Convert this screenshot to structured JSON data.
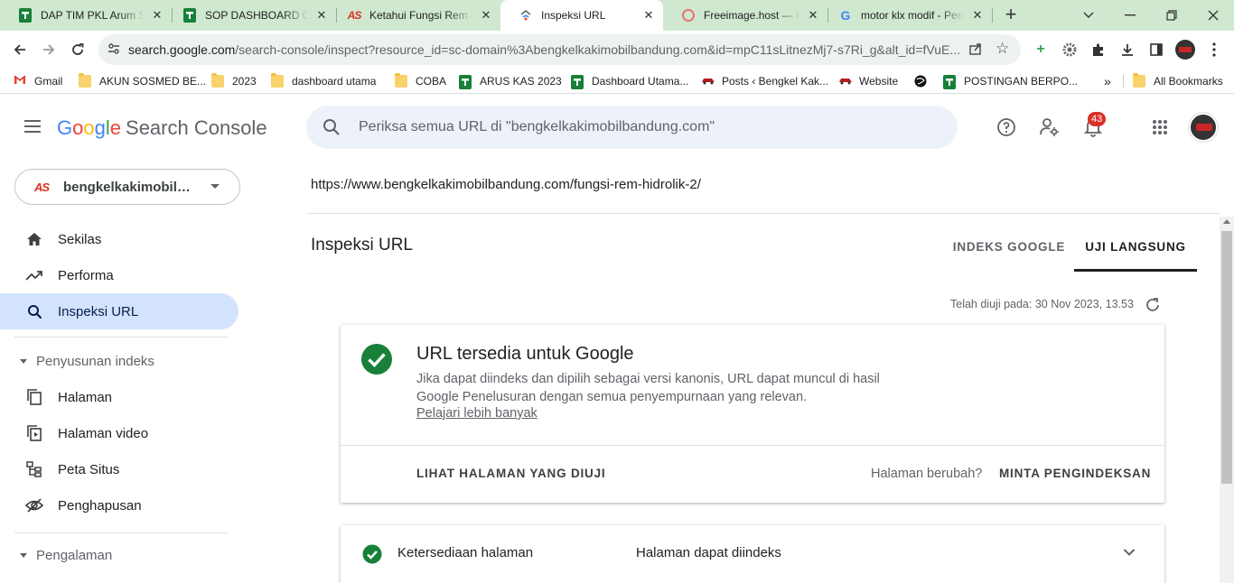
{
  "browser": {
    "tabs": [
      {
        "title": "DAP TIM PKL Arum Sa",
        "icon": "sheets-icon",
        "active": false
      },
      {
        "title": "SOP DASHBOARD OP",
        "icon": "sheets-icon",
        "active": false
      },
      {
        "title": "Ketahui Fungsi Rem H",
        "icon": "as-logo-icon",
        "active": false
      },
      {
        "title": "Inspeksi URL",
        "icon": "search-console-icon",
        "active": true
      },
      {
        "title": "Freeimage.host — Ho",
        "icon": "freeimage-icon",
        "active": false
      },
      {
        "title": "motor klx modif - Pen",
        "icon": "google-icon",
        "active": false
      }
    ],
    "url_host": "search.google.com",
    "url_path": "/search-console/inspect?resource_id=sc-domain%3Abengkelkakimobilbandung.com&id=mpC11sLitnezMj7-s7Ri_g&alt_id=fVuE...",
    "bookmarks": [
      {
        "label": "Gmail",
        "icon": "gmail-icon"
      },
      {
        "label": "AKUN SOSMED BE...",
        "icon": "folder-icon"
      },
      {
        "label": "2023",
        "icon": "folder-icon"
      },
      {
        "label": "dashboard utama",
        "icon": "folder-icon"
      },
      {
        "label": "COBA",
        "icon": "folder-icon"
      },
      {
        "label": "ARUS KAS 2023",
        "icon": "sheets-icon"
      },
      {
        "label": "Dashboard Utama...",
        "icon": "sheets-icon"
      },
      {
        "label": "Posts ‹ Bengkel Kak...",
        "icon": "car-icon"
      },
      {
        "label": "Website",
        "icon": "car-icon"
      },
      {
        "label": "",
        "icon": "globe-dark-icon"
      },
      {
        "label": "POSTINGAN BERPO...",
        "icon": "sheets-icon"
      }
    ],
    "overflow_label": "»",
    "all_bookmarks_label": "All Bookmarks"
  },
  "header": {
    "logo_google": [
      "G",
      "o",
      "o",
      "g",
      "l",
      "e"
    ],
    "logo_product": "Search Console",
    "search_placeholder": "Periksa semua URL di \"bengkelkakimobilbandung.com\"",
    "notifications_count": "43"
  },
  "sidebar": {
    "property": "bengkelkakimobilbandung.com",
    "property_short": "bengkelkakimobilba...",
    "items": [
      {
        "label": "Sekilas",
        "icon": "home-icon",
        "active": false
      },
      {
        "label": "Performa",
        "icon": "trending-up-icon",
        "active": false
      },
      {
        "label": "Inspeksi URL",
        "icon": "search-icon",
        "active": true
      }
    ],
    "section_indexing": "Penyusunan indeks",
    "indexing_items": [
      {
        "label": "Halaman",
        "icon": "pages-icon"
      },
      {
        "label": "Halaman video",
        "icon": "video-pages-icon"
      },
      {
        "label": "Peta Situs",
        "icon": "sitemap-icon"
      },
      {
        "label": "Penghapusan",
        "icon": "removals-icon"
      }
    ],
    "section_experience": "Pengalaman"
  },
  "main": {
    "inspected_url": "https://www.bengkelkakimobilbandung.com/fungsi-rem-hidrolik-2/",
    "title": "Inspeksi URL",
    "tabs": [
      {
        "label": "INDEKS GOOGLE",
        "active": false
      },
      {
        "label": "UJI LANGSUNG",
        "active": true
      }
    ],
    "tested_on": "Telah diuji pada: 30 Nov 2023, 13.53",
    "status_card": {
      "title": "URL tersedia untuk Google",
      "description": "Jika dapat diindeks dan dipilih sebagai versi kanonis, URL dapat muncul di hasil Google Penelusuran dengan semua penyempurnaan yang relevan.",
      "learn_more": "Pelajari lebih banyak",
      "view_tested_page": "LIHAT HALAMAN YANG DIUJI",
      "page_changed": "Halaman berubah?",
      "request_indexing": "MINTA PENGINDEKSAN"
    },
    "availability": {
      "label": "Ketersediaan halaman",
      "value": "Halaman dapat diindeks"
    }
  },
  "colors": {
    "accent_active_nav": "#d3e3fd",
    "success_green": "#188038",
    "tabstrip": "#cfe8cf",
    "badge_red": "#d93025"
  }
}
